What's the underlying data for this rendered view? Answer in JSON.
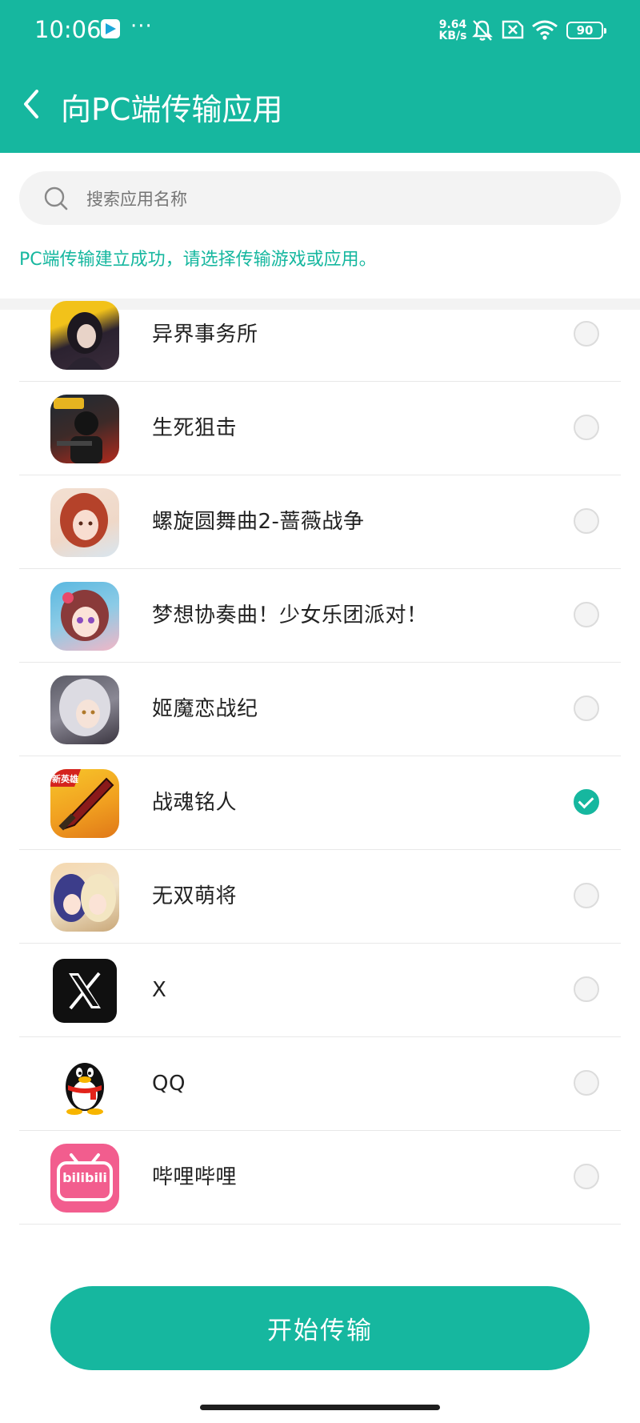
{
  "status_bar": {
    "time": "10:06",
    "more": "···",
    "net_speed_value": "9.64",
    "net_speed_unit": "KB/s",
    "battery": "90",
    "icons": [
      "app-store-icon",
      "bell-muted-icon",
      "sim-blocked-icon",
      "wifi-icon",
      "battery-icon"
    ]
  },
  "header": {
    "title": "向PC端传输应用",
    "back_icon": "chevron-left-icon"
  },
  "search": {
    "placeholder": "搜索应用名称",
    "value": ""
  },
  "message": "PC端传输建立成功，请选择传输游戏或应用。",
  "apps": [
    {
      "name": "异界事务所",
      "selected": false,
      "icon": "game-icon-dark-anime"
    },
    {
      "name": "生死狙击",
      "selected": false,
      "icon": "game-icon-soldier"
    },
    {
      "name": "螺旋圆舞曲2-蔷薇战争",
      "selected": false,
      "icon": "game-icon-redhair-girl"
    },
    {
      "name": "梦想协奏曲！少女乐团派对！",
      "selected": false,
      "icon": "game-icon-band-girl"
    },
    {
      "name": "姬魔恋战纪",
      "selected": false,
      "icon": "game-icon-silverhair-girl"
    },
    {
      "name": "战魂铭人",
      "selected": true,
      "icon": "game-icon-sword",
      "icon_badge": "新英雄"
    },
    {
      "name": "无双萌将",
      "selected": false,
      "icon": "game-icon-two-girls"
    },
    {
      "name": "X",
      "selected": false,
      "icon": "x-logo-icon"
    },
    {
      "name": "QQ",
      "selected": false,
      "icon": "qq-penguin-icon"
    },
    {
      "name": "哔哩哔哩",
      "selected": false,
      "icon": "bilibili-icon",
      "icon_text": "bilibili"
    }
  ],
  "start_button": "开始传输",
  "colors": {
    "accent": "#16b79f",
    "background": "#ffffff",
    "divider": "#e8e8e8"
  }
}
